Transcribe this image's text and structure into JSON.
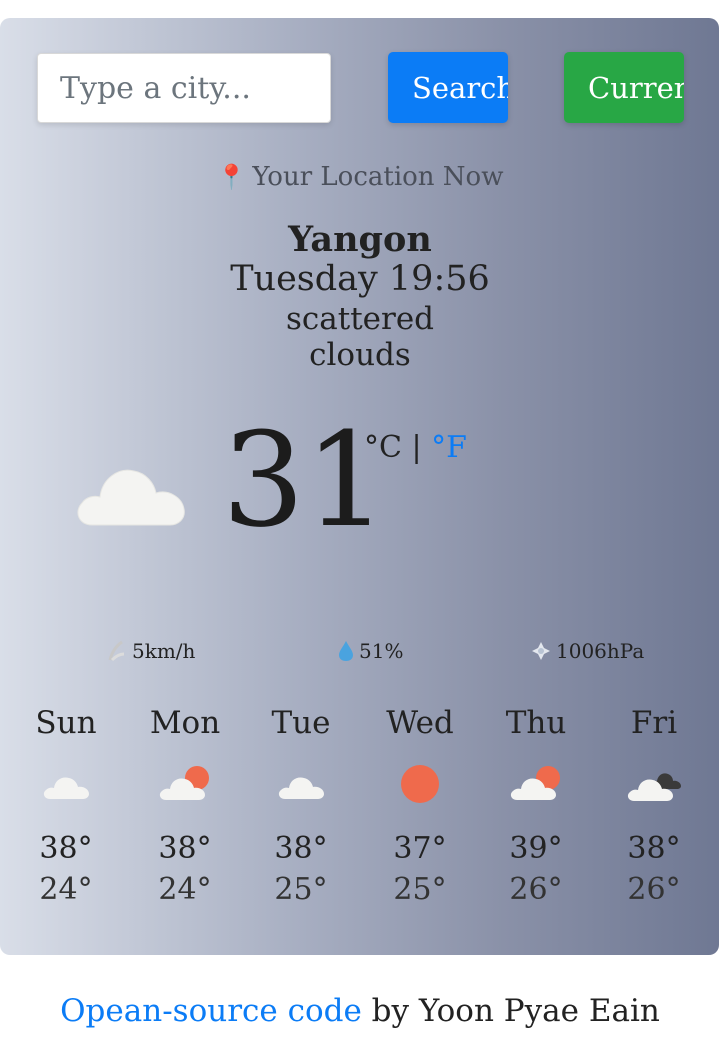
{
  "search": {
    "placeholder": "Type a city...",
    "search_label": "Search",
    "current_label": "Current"
  },
  "location": {
    "label": "Your Location Now",
    "city": "Yangon",
    "datetime": "Tuesday 19:56",
    "description_line1": "scattered",
    "description_line2": "clouds",
    "icon": "cloud-icon"
  },
  "current": {
    "temperature": "31",
    "unit_c": "°C",
    "separator": "|",
    "unit_f": "°F"
  },
  "metrics": {
    "wind": "5km/h",
    "humidity": "51%",
    "pressure": "1006hPa"
  },
  "forecast": [
    {
      "day": "Sun",
      "icon": "cloud-icon",
      "high": "38°",
      "low": "24°"
    },
    {
      "day": "Mon",
      "icon": "sun-behind-cloud-icon",
      "high": "38°",
      "low": "24°"
    },
    {
      "day": "Tue",
      "icon": "cloud-icon",
      "high": "38°",
      "low": "25°"
    },
    {
      "day": "Wed",
      "icon": "sun-icon",
      "high": "37°",
      "low": "25°"
    },
    {
      "day": "Thu",
      "icon": "sun-behind-cloud-icon",
      "high": "39°",
      "low": "26°"
    },
    {
      "day": "Fri",
      "icon": "dark-clouds-icon",
      "high": "38°",
      "low": "26°"
    }
  ],
  "footer": {
    "link_text": "Opean-source code",
    "byline": " by Yoon Pyae Eain"
  },
  "colors": {
    "primary": "#0b7cf6",
    "success": "#28a745",
    "sun": "#ef6a4c"
  }
}
